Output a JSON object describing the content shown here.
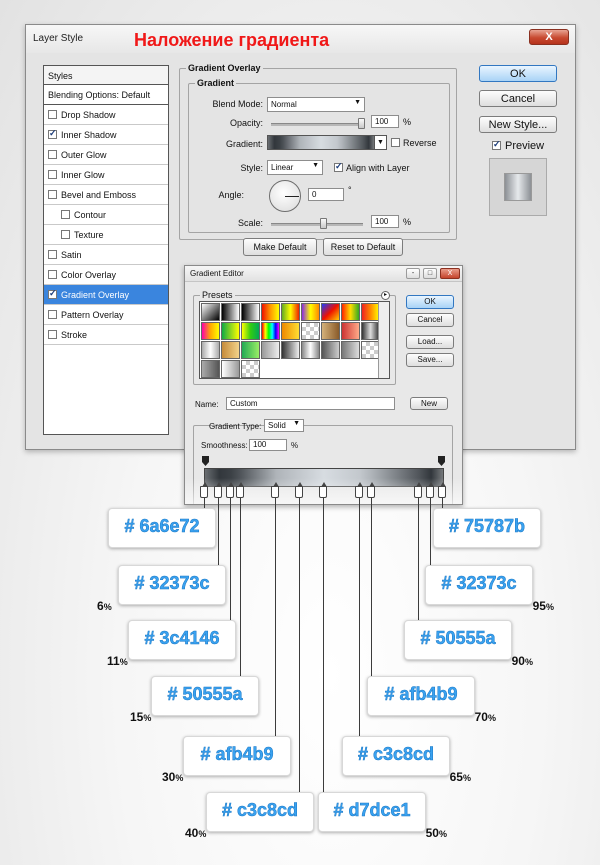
{
  "layer_style": {
    "title": "Layer Style",
    "caption": "Наложение градиента",
    "close_label": "X",
    "styles_header": "Styles",
    "blending_options": "Blending Options: Default",
    "items": [
      {
        "label": "Drop Shadow",
        "checked": false,
        "sub": false
      },
      {
        "label": "Inner Shadow",
        "checked": true,
        "sub": false
      },
      {
        "label": "Outer Glow",
        "checked": false,
        "sub": false
      },
      {
        "label": "Inner Glow",
        "checked": false,
        "sub": false
      },
      {
        "label": "Bevel and Emboss",
        "checked": false,
        "sub": false
      },
      {
        "label": "Contour",
        "checked": false,
        "sub": true
      },
      {
        "label": "Texture",
        "checked": false,
        "sub": true
      },
      {
        "label": "Satin",
        "checked": false,
        "sub": false
      },
      {
        "label": "Color Overlay",
        "checked": false,
        "sub": false
      },
      {
        "label": "Gradient Overlay",
        "checked": true,
        "sub": false,
        "selected": true
      },
      {
        "label": "Pattern Overlay",
        "checked": false,
        "sub": false
      },
      {
        "label": "Stroke",
        "checked": false,
        "sub": false
      }
    ],
    "gradient_overlay": {
      "section_title": "Gradient Overlay",
      "group_title": "Gradient",
      "blend_mode_label": "Blend Mode:",
      "blend_mode_value": "Normal",
      "opacity_label": "Opacity:",
      "opacity_value": "100",
      "opacity_unit": "%",
      "gradient_label": "Gradient:",
      "reverse_label": "Reverse",
      "style_label": "Style:",
      "style_value": "Linear",
      "align_label": "Align with Layer",
      "angle_label": "Angle:",
      "angle_value": "0",
      "angle_unit": "°",
      "scale_label": "Scale:",
      "scale_value": "100",
      "scale_unit": "%",
      "make_default": "Make Default",
      "reset_default": "Reset to Default"
    },
    "buttons": {
      "ok": "OK",
      "cancel": "Cancel",
      "new_style": "New Style...",
      "preview": "Preview"
    }
  },
  "gradient_editor": {
    "title": "Gradient Editor",
    "window_controls": [
      "-",
      "□",
      "X"
    ],
    "presets_label": "Presets",
    "ok": "OK",
    "cancel": "Cancel",
    "load": "Load...",
    "save": "Save...",
    "name_label": "Name:",
    "name_value": "Custom",
    "new_button": "New",
    "gradient_type_label": "Gradient Type:",
    "gradient_type_value": "Solid",
    "smoothness_label": "Smoothness:",
    "smoothness_value": "100",
    "smoothness_unit": "%"
  },
  "color_stops": [
    {
      "hex": "# 6a6e72",
      "percent": "",
      "pos": 0
    },
    {
      "hex": "# 32373c",
      "percent": "6",
      "pos": 6
    },
    {
      "hex": "# 3c4146",
      "percent": "11",
      "pos": 11
    },
    {
      "hex": "# 50555a",
      "percent": "15",
      "pos": 15
    },
    {
      "hex": "# afb4b9",
      "percent": "30",
      "pos": 30
    },
    {
      "hex": "# c3c8cd",
      "percent": "40",
      "pos": 40
    },
    {
      "hex": "# d7dce1",
      "percent": "50",
      "pos": 50
    },
    {
      "hex": "# c3c8cd",
      "percent": "65",
      "pos": 65
    },
    {
      "hex": "# afb4b9",
      "percent": "70",
      "pos": 70
    },
    {
      "hex": "# 50555a",
      "percent": "90",
      "pos": 90
    },
    {
      "hex": "# 32373c",
      "percent": "95",
      "pos": 95
    },
    {
      "hex": "# 75787b",
      "percent": "",
      "pos": 100
    }
  ],
  "percent_sign": "%",
  "colors": {
    "caption_red": "#f01818",
    "selection_blue": "#3a85de",
    "hex_blue": "#3aa2f0"
  }
}
